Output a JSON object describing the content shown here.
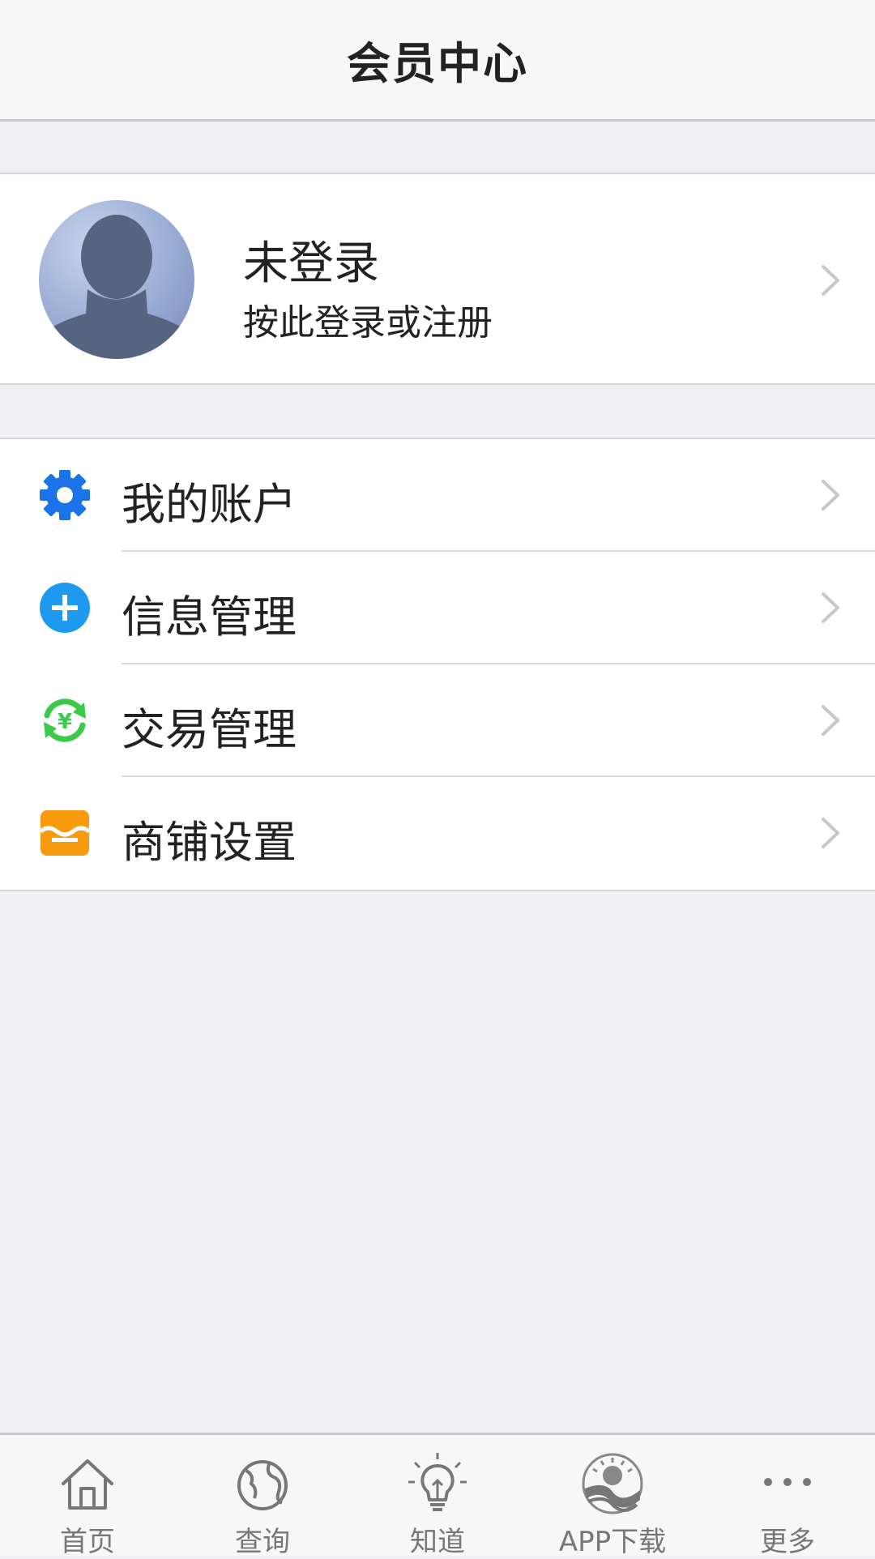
{
  "header": {
    "title": "会员中心"
  },
  "profile": {
    "name": "未登录",
    "subtitle": "按此登录或注册"
  },
  "menu": {
    "items": [
      {
        "label": "我的账户",
        "icon": "gear-icon",
        "color": "#1a73e8"
      },
      {
        "label": "信息管理",
        "icon": "plus-circle-icon",
        "color": "#1e9bf0"
      },
      {
        "label": "交易管理",
        "icon": "yuan-exchange-icon",
        "color": "#3cc84a"
      },
      {
        "label": "商铺设置",
        "icon": "shop-icon",
        "color": "#f79a0e"
      }
    ]
  },
  "tabbar": {
    "items": [
      {
        "label": "首页",
        "icon": "home-icon"
      },
      {
        "label": "查询",
        "icon": "globe-icon"
      },
      {
        "label": "知道",
        "icon": "lightbulb-icon"
      },
      {
        "label": "APP下载",
        "icon": "app-logo-icon"
      },
      {
        "label": "更多",
        "icon": "more-dots-icon"
      }
    ]
  },
  "colors": {
    "background": "#efeff4",
    "bar": "#f7f7f7",
    "chevron": "#c7c7cc",
    "tab_inactive": "#777777"
  }
}
